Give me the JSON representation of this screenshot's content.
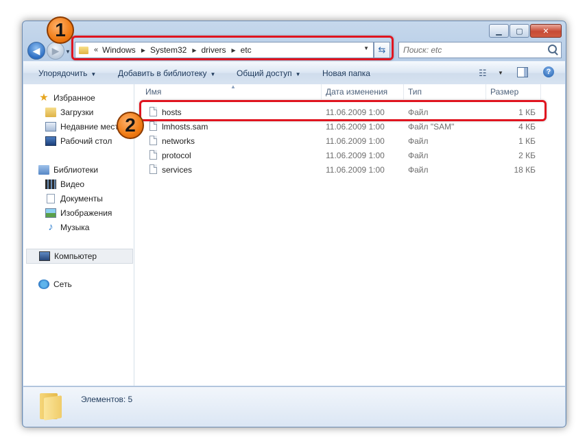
{
  "address": {
    "overflow": "«",
    "crumbs": [
      "Windows",
      "System32",
      "drivers",
      "etc"
    ]
  },
  "search": {
    "placeholder": "Поиск: etc"
  },
  "toolbar": {
    "organize": "Упорядочить",
    "add_library": "Добавить в библиотеку",
    "share": "Общий доступ",
    "new_folder": "Новая папка",
    "help": "?"
  },
  "nav": {
    "favorites": "Избранное",
    "downloads": "Загрузки",
    "recent": "Недавние места",
    "desktop": "Рабочий стол",
    "libraries": "Библиотеки",
    "video": "Видео",
    "documents": "Документы",
    "images": "Изображения",
    "music": "Музыка",
    "computer": "Компьютер",
    "network": "Сеть"
  },
  "columns": {
    "name": "Имя",
    "date": "Дата изменения",
    "type": "Тип",
    "size": "Размер"
  },
  "files": [
    {
      "name": "hosts",
      "date": "11.06.2009 1:00",
      "type": "Файл",
      "size": "1 КБ"
    },
    {
      "name": "lmhosts.sam",
      "date": "11.06.2009 1:00",
      "type": "Файл \"SAM\"",
      "size": "4 КБ"
    },
    {
      "name": "networks",
      "date": "11.06.2009 1:00",
      "type": "Файл",
      "size": "1 КБ"
    },
    {
      "name": "protocol",
      "date": "11.06.2009 1:00",
      "type": "Файл",
      "size": "2 КБ"
    },
    {
      "name": "services",
      "date": "11.06.2009 1:00",
      "type": "Файл",
      "size": "18 КБ"
    }
  ],
  "status": {
    "items_count": "Элементов: 5"
  },
  "annotations": {
    "badge1": "1",
    "badge2": "2"
  },
  "colors": {
    "highlight": "#e0141f",
    "badge": "#f07c15"
  }
}
